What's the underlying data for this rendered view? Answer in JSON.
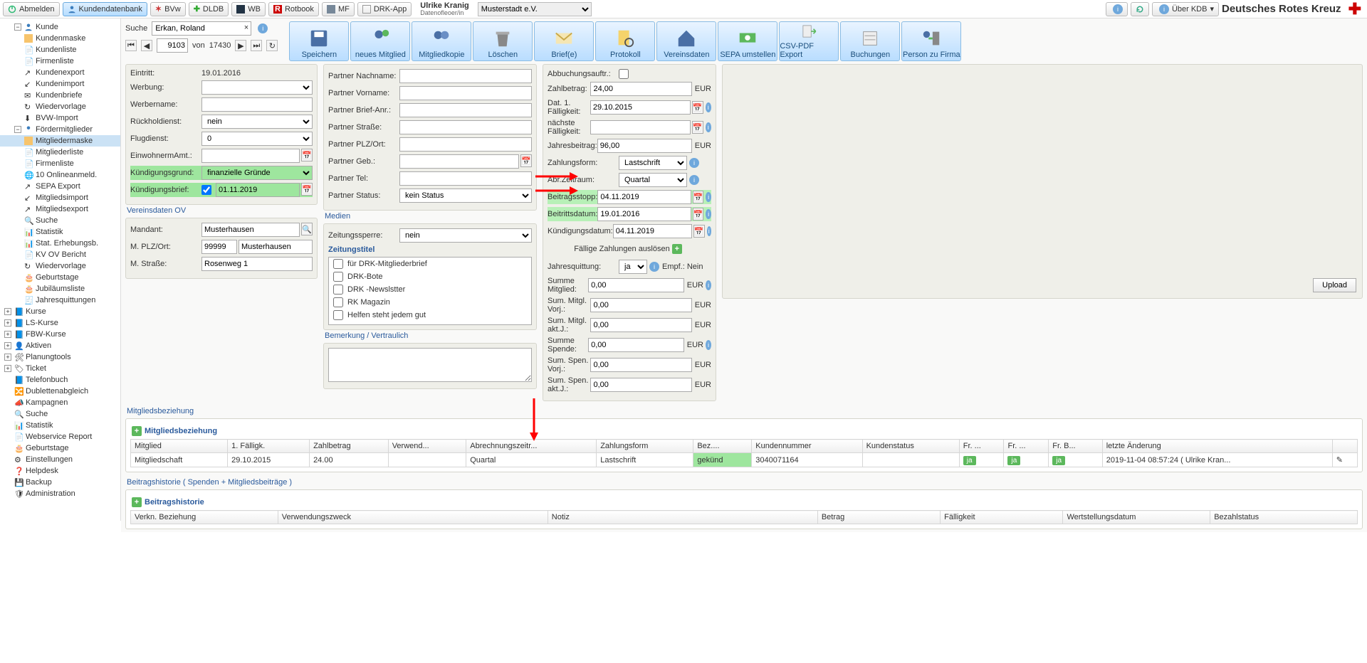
{
  "top": {
    "logout": "Abmelden",
    "kdb": "Kundendatenbank",
    "bvw": "BVw",
    "dldb": "DLDB",
    "wb": "WB",
    "rotbook": "Rotbook",
    "mf": "MF",
    "drkapp": "DRK-App",
    "user_name": "Ulrike Kranig",
    "user_role": "Datenofleoer/in",
    "org": "Musterstadt e.V.",
    "about": "Über KDB",
    "brand": "Deutsches Rotes Kreuz"
  },
  "tree": {
    "kunde": "Kunde",
    "items1": [
      "Kundenmaske",
      "Kundenliste",
      "Firmenliste",
      "Kundenexport",
      "Kundenimport",
      "Kundenbriefe",
      "Wiedervorlage",
      "BVW-Import"
    ],
    "foerder": "Fördermitglieder",
    "items2": [
      "Mitgliedermaske",
      "Mitgliederliste",
      "Firmenliste",
      "10  Onlineanmeld.",
      "SEPA Export",
      "Mitgliedsimport",
      "Mitgliedsexport",
      "Suche",
      "Statistik",
      "Stat. Erhebungsb.",
      "KV OV Bericht",
      "Wiedervorlage",
      "Geburtstage",
      "Jubiläumsliste",
      "Jahresquittungen"
    ],
    "more": [
      "Kurse",
      "LS-Kurse",
      "FBW-Kurse",
      "Aktiven",
      "Planungtools",
      "Ticket",
      "Telefonbuch",
      "Dublettenabgleich",
      "Kampagnen",
      "Suche",
      "Statistik",
      "Webservice Report",
      "Geburtstage",
      "Einstellungen",
      "Helpdesk",
      "Backup",
      "Administration"
    ]
  },
  "search": {
    "label": "Suche",
    "value": "Erkan, Roland",
    "rec": "9103",
    "von": "von",
    "total": "17430"
  },
  "toolbar": [
    "Speichern",
    "neues Mitglied",
    "Mitgliedkopie",
    "Löschen",
    "Brief(e)",
    "Protokoll",
    "Vereinsdaten",
    "SEPA umstellen",
    "CSV-PDF Export",
    "Buchungen",
    "Person zu Firma"
  ],
  "c1": {
    "eintritt_l": "Eintritt:",
    "eintritt": "19.01.2016",
    "werbung_l": "Werbung:",
    "werber_l": "Werbername:",
    "rueck_l": "Rückholdienst:",
    "rueck": "nein",
    "flug_l": "Flugdienst:",
    "flug": "0",
    "einw_l": "EinwohnermAmt.:",
    "kgrund_l": "Kündigungsgrund:",
    "kgrund": "finanzielle Gründe",
    "kbrief_l": "Kündigungsbrief:",
    "kbrief": "01.11.2019"
  },
  "ov": {
    "title": "Vereinsdaten OV",
    "mandant_l": "Mandant:",
    "mandant": "Musterhausen",
    "plz_l": "M. PLZ/Ort:",
    "plz": "99999",
    "ort": "Musterhausen",
    "str_l": "M. Straße:",
    "str": "Rosenweg 1"
  },
  "c2": {
    "pnach": "Partner Nachname:",
    "pvor": "Partner Vorname:",
    "pbrief": "Partner Brief-Anr.:",
    "pstr": "Partner Straße:",
    "pplz": "Partner PLZ/Ort:",
    "pgeb": "Partner Geb.:",
    "ptel": "Partner Tel:",
    "pstat": "Partner Status:",
    "pstat_v": "kein Status",
    "medien": "Medien",
    "zsperre_l": "Zeitungssperre:",
    "zsperre": "nein",
    "ztitel": "Zeitungstitel",
    "zlist": [
      "für DRK-Mitgliederbrief",
      "DRK-Bote",
      "DRK -Newslstter",
      "RK Magazin",
      "Helfen steht jedem gut"
    ],
    "bem": "Bemerkung / Vertraulich"
  },
  "c3": {
    "abuch": "Abbuchungsauftr.:",
    "zb_l": "Zahlbetrag:",
    "zb": "24,00",
    "d1_l": "Dat. 1. Fälligkeit:",
    "d1": "29.10.2015",
    "nf_l": "nächste Fälligkeit:",
    "jb_l": "Jahresbeitrag:",
    "jb": "96,00",
    "zf_l": "Zahlungsform:",
    "zf": "Lastschrift",
    "az_l": "Abr.Zeitraum:",
    "az": "Quartal",
    "bs_l": "Beitragsstopp:",
    "bs": "04.11.2019",
    "bd_l": "Beitrittsdatum:",
    "bd": "19.01.2016",
    "kd_l": "Kündigungsdatum:",
    "kd": "04.11.2019",
    "fza": "Fällige Zahlungen auslösen",
    "jq_l": "Jahresquittung:",
    "jq": "ja",
    "empf": "Empf.: Nein",
    "sm_l": "Summe Mitglied:",
    "sm": "0,00",
    "smv_l": "Sum. Mitgl. Vorj.:",
    "smv": "0,00",
    "sma_l": "Sum. Mitgl. akt.J.:",
    "sma": "0,00",
    "ss_l": "Summe Spende:",
    "ss": "0,00",
    "ssv_l": "Sum. Spen. Vorj.:",
    "ssv": "0,00",
    "ssa_l": "Sum. Spen. akt.J.:",
    "ssa": "0,00",
    "eur": "EUR"
  },
  "upload": "Upload",
  "mb": {
    "sec": "Mitgliedsbeziehung",
    "title": "Mitgliedsbeziehung",
    "h": [
      "Mitglied",
      "1. Fälligk.",
      "Zahlbetrag",
      "Verwend...",
      "Abrechnungszeitr...",
      "Zahlungsform",
      "Bez....",
      "Kundennummer",
      "Kundenstatus",
      "Fr. ...",
      "Fr. ...",
      "Fr. B...",
      "letzte Änderung"
    ],
    "r": [
      "Mitgliedschaft",
      "29.10.2015",
      "24.00",
      "",
      "Quartal",
      "Lastschrift",
      "gekünd",
      "3040071164",
      "",
      "ja",
      "ja",
      "ja",
      "2019-11-04 08:57:24 ( Ulrike Kran..."
    ]
  },
  "bh": {
    "sec": "Beitragshistorie ( Spenden + Mitgliedsbeiträge )",
    "title": "Beitragshistorie",
    "h": [
      "Verkn. Beziehung",
      "Verwendungszweck",
      "Notiz",
      "Betrag",
      "Fälligkeit",
      "Wertstellungsdatum",
      "Bezahlstatus"
    ]
  }
}
